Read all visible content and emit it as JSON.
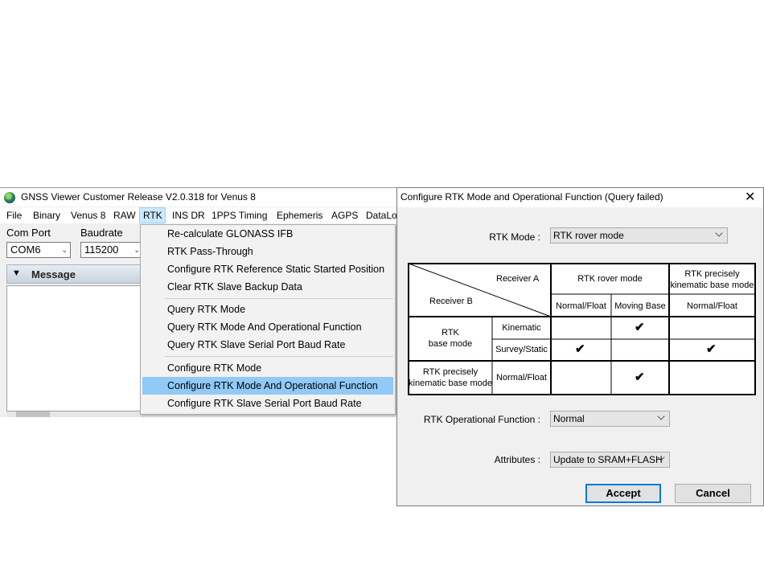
{
  "main_window": {
    "title": "GNSS Viewer Customer Release V2.0.318 for Venus 8",
    "menu": [
      "File",
      "Binary",
      "Venus 8",
      "RAW",
      "RTK",
      "INS DR",
      "1PPS Timing",
      "Ephemeris",
      "AGPS",
      "DataLo"
    ],
    "active_menu": "RTK",
    "com_port_label": "Com Port",
    "com_port_value": "COM6",
    "baudrate_label": "Baudrate",
    "baudrate_value": "115200",
    "message_label": "Message"
  },
  "rtk_menu": {
    "items": [
      "Re-calculate GLONASS IFB",
      "RTK Pass-Through",
      "Configure RTK Reference Static Started Position",
      "Clear RTK Slave Backup Data",
      "Query RTK Mode",
      "Query RTK Mode And Operational Function",
      "Query RTK Slave Serial Port Baud Rate",
      "Configure RTK Mode",
      "Configure RTK Mode And Operational Function",
      "Configure RTK Slave Serial Port Baud Rate"
    ],
    "highlighted": "Configure RTK Mode And Operational Function"
  },
  "dialog": {
    "title": "Configure RTK Mode and Operational Function (Query failed)",
    "rtk_mode_label": "RTK Mode :",
    "rtk_mode_value": "RTK rover mode",
    "table": {
      "receiver_a": "Receiver A",
      "receiver_b": "Receiver B",
      "col_group_1": "RTK rover mode",
      "col_group_2": "RTK precisely kinematic base mode",
      "col_group_2_l1": "RTK precisely",
      "col_group_2_l2": "kinematic base mode",
      "sub_cols": [
        "Normal/Float",
        "Moving Base",
        "Normal/Float"
      ],
      "row_group_1_l1": "RTK",
      "row_group_1_l2": "base mode",
      "row_group_2_l1": "RTK precisely",
      "row_group_2_l2": "kinematic base mode",
      "sub_rows": [
        "Kinematic",
        "Survey/Static",
        "Normal/Float"
      ],
      "check_glyph": "✔",
      "checks": [
        [
          false,
          true,
          false
        ],
        [
          true,
          false,
          true
        ],
        [
          false,
          true,
          false
        ]
      ]
    },
    "op_function_label": "RTK Operational Function :",
    "op_function_value": "Normal",
    "attributes_label": "Attributes :",
    "attributes_value": "Update to SRAM+FLASH",
    "accept_label": "Accept",
    "cancel_label": "Cancel",
    "close_glyph": "✕"
  }
}
